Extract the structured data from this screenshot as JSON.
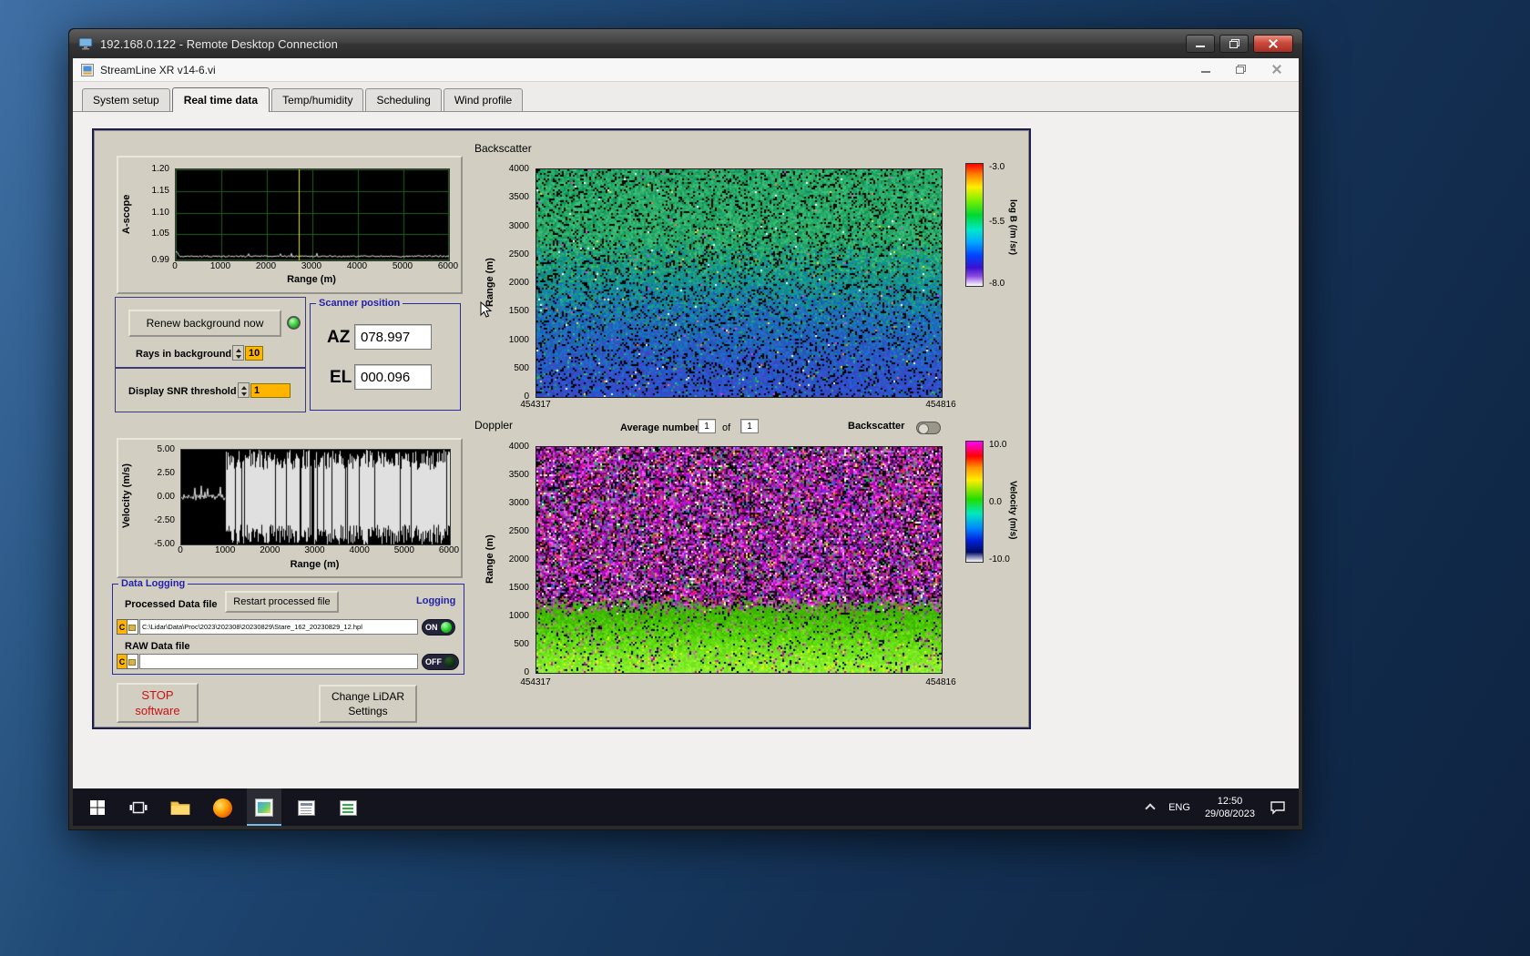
{
  "rdp": {
    "title": "192.168.0.122 - Remote Desktop Connection"
  },
  "app": {
    "title": "StreamLine XR v14-6.vi",
    "tabs": [
      {
        "label": "System setup",
        "active": false
      },
      {
        "label": "Real time data",
        "active": true
      },
      {
        "label": "Temp/humidity",
        "active": false
      },
      {
        "label": "Scheduling",
        "active": false
      },
      {
        "label": "Wind profile",
        "active": false
      }
    ]
  },
  "panel": {
    "background": {
      "renew_button": "Renew background now",
      "rays_label": "Rays in background",
      "rays_value": "10"
    },
    "snr": {
      "label": "Display SNR threshold",
      "value": "1"
    },
    "scanner": {
      "title": "Scanner position",
      "az_label": "AZ",
      "az_value": "078.997",
      "el_label": "EL",
      "el_value": "000.096"
    },
    "doppler_controls": {
      "avg_label": "Average number",
      "avg_value": "1",
      "of_label": "of",
      "avg_total": "1",
      "toggle_label": "Backscatter"
    },
    "logging": {
      "title": "Data Logging",
      "processed_label": "Processed Data file",
      "restart_button": "Restart processed file",
      "logging_label": "Logging",
      "drive": "C",
      "processed_path": "C:\\Lidar\\Data\\Proc\\2023\\202308\\20230829\\Stare_162_20230829_12.hpl",
      "on_label": "ON",
      "raw_label": "RAW Data file",
      "raw_path": "",
      "off_label": "OFF"
    },
    "stop_button_line1": "STOP",
    "stop_button_line2": "software",
    "change_button_line1": "Change LiDAR",
    "change_button_line2": "Settings"
  },
  "taskbar": {
    "language": "ENG",
    "time": "12:50",
    "date": "29/08/2023"
  },
  "colors": {
    "panel_tan": "#d2cec2",
    "group_blue": "#2a2aa0",
    "field_orange": "#ffb400",
    "led_green": "#2ec82e",
    "stop_red": "#cc1111",
    "cursor_yellow": "#e6e600"
  },
  "chart_data": [
    {
      "id": "a-scope",
      "type": "line",
      "ylabel": "A-scope",
      "xlabel": "Range (m)",
      "xlim": [
        0,
        6000
      ],
      "ylim": [
        1.2,
        0.99
      ],
      "xtick_labels": [
        "0",
        "1000",
        "2000",
        "3000",
        "4000",
        "5000",
        "6000"
      ],
      "ytick_labels": [
        "1.20",
        "1.15",
        "1.10",
        "1.05",
        "0.99"
      ],
      "grid": true,
      "plot_bg": "#000000",
      "line_color": "#e8e8e8",
      "series": [
        {
          "name": "background signal",
          "summary": "flat noisy baseline near 1.00 across 0-6000 m with a small spike to about 1.01 near 0 m"
        }
      ],
      "annotations": [
        {
          "type": "vline",
          "x": 2700,
          "color": "#e6e600"
        }
      ]
    },
    {
      "id": "backscatter",
      "type": "heatmap",
      "title": "Backscatter",
      "ylabel": "Range (m)",
      "x_range": [
        454317,
        454816
      ],
      "y_range": [
        0,
        4000
      ],
      "xtick_labels": [
        "454317",
        "454816"
      ],
      "ytick_labels": [
        "4000",
        "3500",
        "3000",
        "2500",
        "2000",
        "1500",
        "1000",
        "500",
        "0"
      ],
      "colorbar": {
        "label": "log B (/m /sr)",
        "tick_labels": [
          "-3.0",
          "-5.5",
          "-8.0"
        ],
        "max": -3.0,
        "min": -8.0
      },
      "summary": "speckled time-height backscatter: green/teal noise near -5.5 above ~1500 m grading into blue (lower values) from ~1500 m down to 0 m"
    },
    {
      "id": "doppler",
      "type": "heatmap",
      "title": "Doppler",
      "ylabel": "Range (m)",
      "x_range": [
        454317,
        454816
      ],
      "y_range": [
        0,
        4000
      ],
      "xtick_labels": [
        "454317",
        "454816"
      ],
      "ytick_labels": [
        "4000",
        "3500",
        "3000",
        "2500",
        "2000",
        "1500",
        "1000",
        "500",
        "0"
      ],
      "colorbar": {
        "label": "Velocity (m/s)",
        "tick_labels": [
          "10.0",
          "0.0",
          "-10.0"
        ],
        "max": 10.0,
        "min": -10.0
      },
      "summary": "random magenta/purple velocity noise above ~900 m; coherent green/yellow-green band near 0 m/s from the surface up to ~900 m"
    },
    {
      "id": "velocity",
      "type": "line",
      "ylabel": "Velocity (m/s)",
      "xlabel": "Range (m)",
      "xlim": [
        0,
        6000
      ],
      "ylim": [
        5.0,
        -5.0
      ],
      "xtick_labels": [
        "0",
        "1000",
        "2000",
        "3000",
        "4000",
        "5000",
        "6000"
      ],
      "ytick_labels": [
        "5.00",
        "2.50",
        "0.00",
        "-2.50",
        "-5.00"
      ],
      "plot_bg": "#000000",
      "line_color": "#e8e8e8",
      "series": [
        {
          "name": "velocity",
          "summary": "small fluctuations near 0 m/s from 0 to ~1100 m, then full-scale +/-5 m/s noise from ~1100 m to 6000 m"
        }
      ]
    }
  ]
}
